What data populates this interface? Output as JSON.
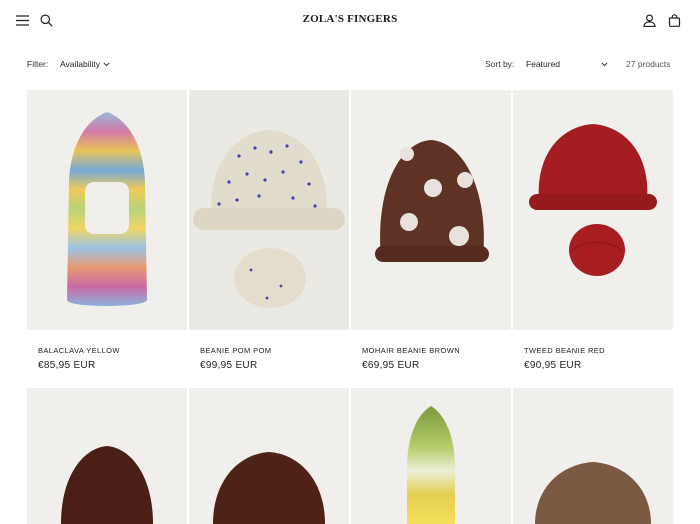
{
  "header": {
    "logo": "ZOLA'S FINGERS",
    "icons": [
      "menu-icon",
      "search-icon",
      "account-icon",
      "cart-icon"
    ]
  },
  "filters": {
    "filter_label": "Filter:",
    "availability_label": "Availability",
    "sort_label": "Sort by:",
    "sort_value": "Featured",
    "product_count": "27 products"
  },
  "products": [
    {
      "title": "BALACLAVA YELLOW",
      "price": "€85,95 EUR"
    },
    {
      "title": "BEANIE POM POM",
      "price": "€99,95 EUR"
    },
    {
      "title": "MOHAIR BEANIE BROWN",
      "price": "€69,95 EUR"
    },
    {
      "title": "TWEED BEANIE RED",
      "price": "€90,95 EUR"
    }
  ],
  "colors": {
    "text": "#121212",
    "background": "#ffffff",
    "image_bg": "#f1efec"
  }
}
